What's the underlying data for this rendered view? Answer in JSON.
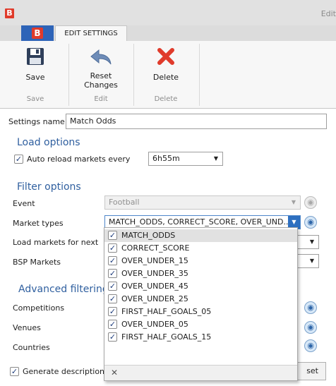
{
  "window": {
    "title": "Edit",
    "app_logo": "B"
  },
  "ribbon": {
    "tab_logo": "B",
    "tab_label": "EDIT SETTINGS",
    "buttons": {
      "save": "Save",
      "reset_line1": "Reset",
      "reset_line2": "Changes",
      "delete": "Delete"
    },
    "groups": {
      "save": "Save",
      "edit": "Edit",
      "delete": "Delete"
    }
  },
  "form": {
    "settings_name_label": "Settings name",
    "settings_name_value": "Match Odds",
    "load_options_heading": "Load options",
    "auto_reload_label": "Auto reload markets every",
    "auto_reload_value": "6h55m",
    "filter_options_heading": "Filter options",
    "event_label": "Event",
    "event_value": "Football",
    "market_types_label": "Market types",
    "market_types_value": "MATCH_ODDS, CORRECT_SCORE, OVER_UND...",
    "load_markets_label": "Load markets for next",
    "bsp_markets_label": "BSP Markets",
    "advanced_heading": "Advanced filtering",
    "competitions_label": "Competitions",
    "venues_label": "Venues",
    "countries_label": "Countries",
    "generate_desc_label": "Generate description fo",
    "reset_button_fragment": "set"
  },
  "dropdown": {
    "items": [
      {
        "label": "MATCH_ODDS",
        "checked": true
      },
      {
        "label": "CORRECT_SCORE",
        "checked": true
      },
      {
        "label": "OVER_UNDER_15",
        "checked": true
      },
      {
        "label": "OVER_UNDER_35",
        "checked": true
      },
      {
        "label": "OVER_UNDER_45",
        "checked": true
      },
      {
        "label": "OVER_UNDER_25",
        "checked": true
      },
      {
        "label": "FIRST_HALF_GOALS_05",
        "checked": true
      },
      {
        "label": "OVER_UNDER_05",
        "checked": true
      },
      {
        "label": "FIRST_HALF_GOALS_15",
        "checked": true
      }
    ],
    "close_symbol": "✕",
    "check_symbol": "✓"
  },
  "icons": {
    "save": "floppy-disk-icon",
    "reset": "undo-arrow-icon",
    "delete": "red-x-icon",
    "dropdown_arrow": "▼",
    "lookup": "eye-icon"
  },
  "colors": {
    "brand_red": "#e03b2b",
    "ribbon_blue": "#2e64b8",
    "heading_blue": "#2f5f9f"
  }
}
